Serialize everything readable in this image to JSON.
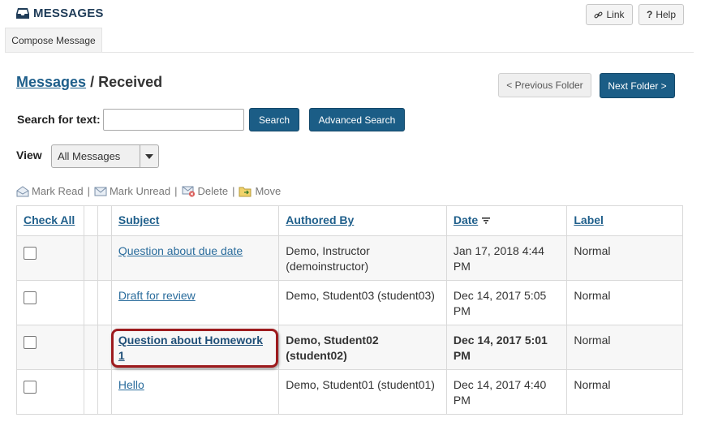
{
  "header": {
    "tool_title": "MESSAGES",
    "link_label": "Link",
    "help_label": "Help",
    "compose_label": "Compose Message"
  },
  "breadcrumb": {
    "root": "Messages",
    "separator": " / ",
    "current": "Received"
  },
  "folder_nav": {
    "prev_label": "< Previous Folder",
    "next_label": "Next Folder >"
  },
  "search": {
    "label": "Search for text:",
    "value": "",
    "button_label": "Search",
    "advanced_label": "Advanced Search"
  },
  "view": {
    "label": "View",
    "selected": "All Messages"
  },
  "actions": {
    "mark_read": "Mark Read",
    "mark_unread": "Mark Unread",
    "delete": "Delete",
    "move": "Move",
    "separator": "|"
  },
  "table": {
    "headers": {
      "check_all": "Check All",
      "subject": "Subject",
      "authored_by": "Authored By",
      "date": "Date",
      "label": "Label"
    },
    "rows": [
      {
        "subject": "Question about due date",
        "author": "Demo, Instructor (demoinstructor)",
        "date": "Jan 17, 2018 4:44 PM",
        "label": "Normal",
        "unread": false,
        "checked": false
      },
      {
        "subject": "Draft for review",
        "author": "Demo, Student03 (student03)",
        "date": "Dec 14, 2017 5:05 PM",
        "label": "Normal",
        "unread": false,
        "checked": false
      },
      {
        "subject": "Question about Homework 1",
        "author": "Demo, Student02 (student02)",
        "date": "Dec 14, 2017 5:01 PM",
        "label": "Normal",
        "unread": true,
        "checked": false
      },
      {
        "subject": "Hello",
        "author": "Demo, Student01 (student01)",
        "date": "Dec 14, 2017 4:40 PM",
        "label": "Normal",
        "unread": false,
        "checked": false
      }
    ]
  },
  "colors": {
    "primary": "#1b5d86",
    "link": "#2a6c9c",
    "highlight": "#9d1b1e"
  }
}
